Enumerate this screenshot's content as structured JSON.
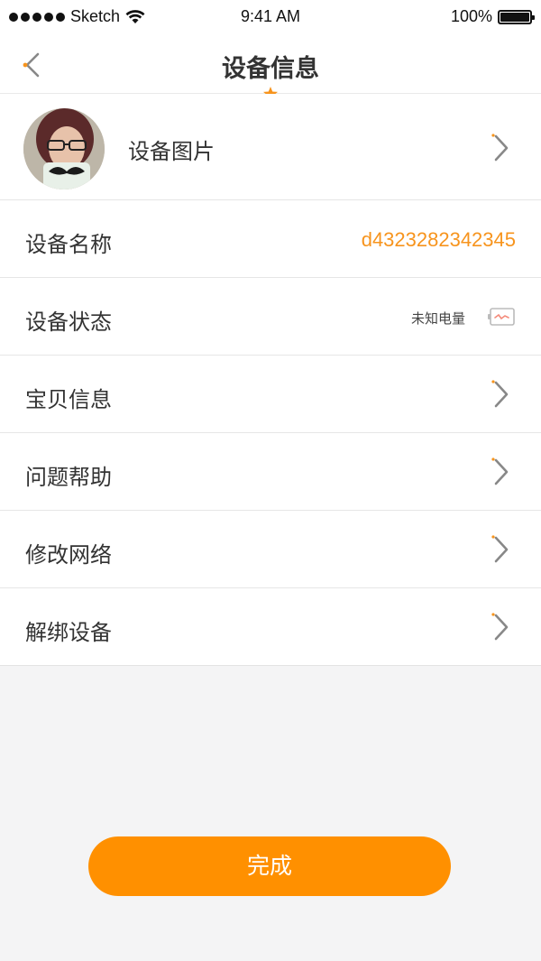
{
  "status_bar": {
    "carrier": "Sketch",
    "time": "9:41 AM",
    "battery_percent": "100%"
  },
  "nav": {
    "title": "设备信息",
    "back_icon": "chevron-left-icon",
    "accent_color": "#f7941d"
  },
  "rows": [
    {
      "label": "设备图片",
      "type": "avatar",
      "icon": "chevron-right-icon"
    },
    {
      "label": "设备名称",
      "value": "d4323282342345"
    },
    {
      "label": "设备状态",
      "note": "未知电量",
      "icon": "battery-unknown-icon"
    },
    {
      "label": "宝贝信息",
      "icon": "chevron-right-icon"
    },
    {
      "label": "问题帮助",
      "icon": "chevron-right-icon"
    },
    {
      "label": "修改网络",
      "icon": "chevron-right-icon"
    },
    {
      "label": "解绑设备",
      "icon": "chevron-right-icon"
    }
  ],
  "done_button": {
    "label": "完成",
    "color": "#ff9000"
  }
}
